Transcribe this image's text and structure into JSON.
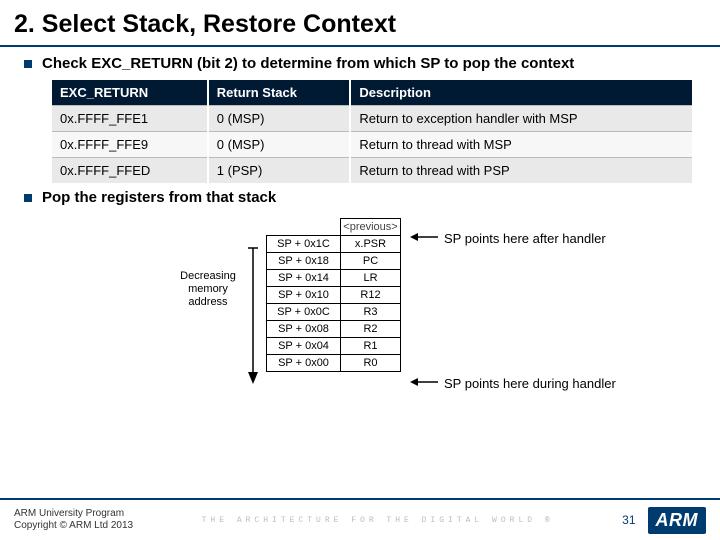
{
  "title": "2. Select Stack, Restore Context",
  "bullets": {
    "check": "Check EXC_RETURN (bit 2) to determine from which SP to pop the context",
    "pop": "Pop the registers from that stack"
  },
  "exc_table": {
    "headers": [
      "EXC_RETURN",
      "Return Stack",
      "Description"
    ],
    "rows": [
      [
        "0x.FFFF_FFE1",
        "0 (MSP)",
        "Return to exception handler with MSP"
      ],
      [
        "0x.FFFF_FFE9",
        "0 (MSP)",
        "Return to thread with MSP"
      ],
      [
        "0x.FFFF_FFED",
        "1 (PSP)",
        "Return to thread with PSP"
      ]
    ]
  },
  "stack_diagram": {
    "decreasing_label": "Decreasing memory address",
    "rows": [
      {
        "addr": "",
        "reg": "<previous>"
      },
      {
        "addr": "SP + 0x1C",
        "reg": "x.PSR"
      },
      {
        "addr": "SP + 0x18",
        "reg": "PC"
      },
      {
        "addr": "SP + 0x14",
        "reg": "LR"
      },
      {
        "addr": "SP + 0x10",
        "reg": "R12"
      },
      {
        "addr": "SP + 0x0C",
        "reg": "R3"
      },
      {
        "addr": "SP + 0x08",
        "reg": "R2"
      },
      {
        "addr": "SP + 0x04",
        "reg": "R1"
      },
      {
        "addr": "SP + 0x00",
        "reg": "R0"
      }
    ],
    "pointer_after": "SP points here after handler",
    "pointer_during": "SP points here during handler"
  },
  "footer": {
    "line1": "ARM University Program",
    "line2": "Copyright © ARM Ltd 2013",
    "tagline": "THE ARCHITECTURE FOR THE DIGITAL WORLD ®",
    "page": "31",
    "logo": "ARM"
  }
}
